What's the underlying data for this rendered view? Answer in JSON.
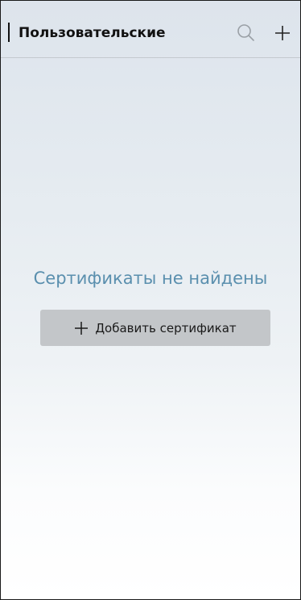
{
  "header": {
    "title": "Пользовательские",
    "search_icon": "search-icon",
    "add_icon": "plus-icon"
  },
  "empty_state": {
    "message": "Сертификаты не найдены",
    "add_button_label": "Добавить сертификат",
    "add_button_icon": "plus-icon"
  },
  "colors": {
    "accent_text": "#5a8fae",
    "button_bg": "#c3c6c9",
    "title_text": "#111111"
  }
}
